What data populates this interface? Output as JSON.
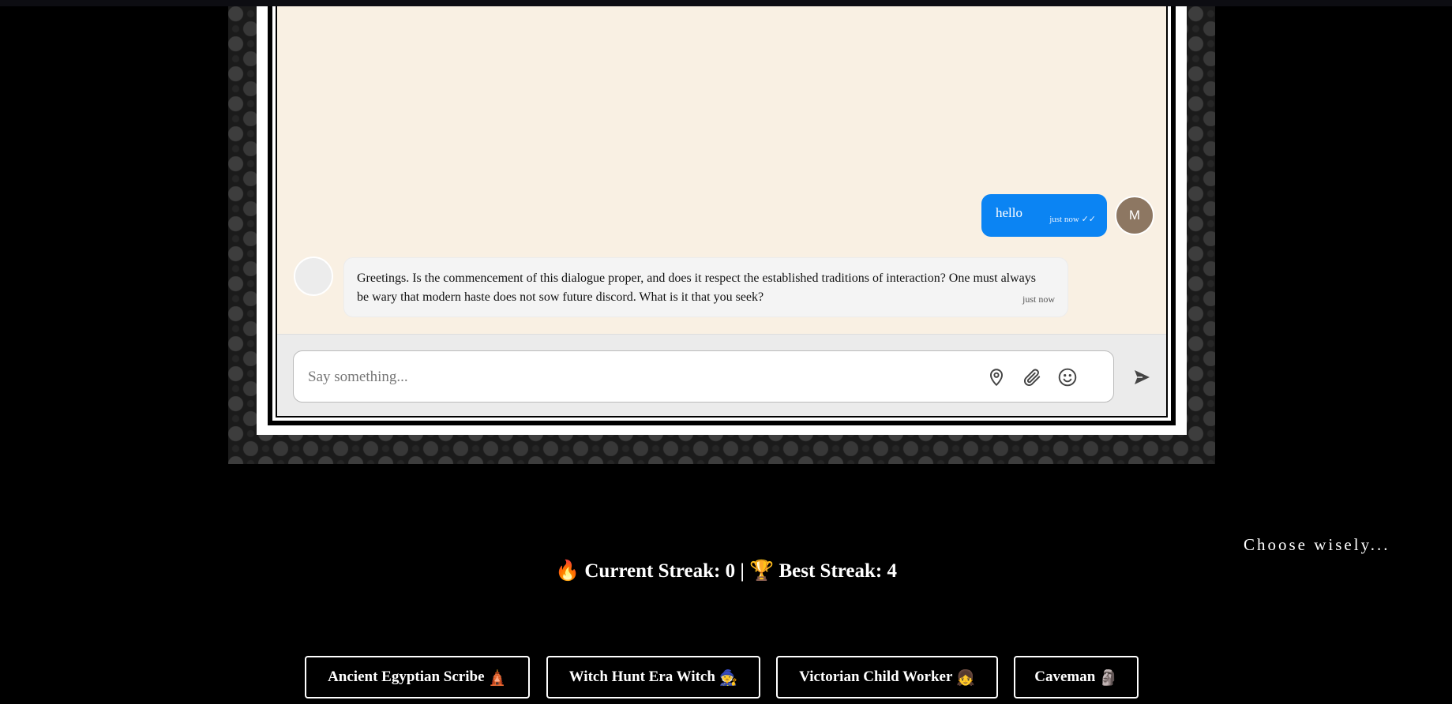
{
  "chat": {
    "messages": [
      {
        "sender": "user",
        "avatar": "M",
        "text": "hello",
        "time": "just now",
        "status": "✓✓"
      },
      {
        "sender": "bot",
        "text": "Greetings. Is the commencement of this dialogue proper, and does it respect the established traditions of interaction? One must always be wary that modern haste does not sow future discord. What is it that you seek?",
        "time": "just now"
      }
    ],
    "input": {
      "placeholder": "Say something...",
      "value": ""
    },
    "icons": [
      "location-pin-icon",
      "paperclip-icon",
      "smiley-icon",
      "send-icon"
    ]
  },
  "tagline": "Choose wisely...",
  "streak": {
    "current_icon": "🔥",
    "current_text": "Current Streak: 0 |",
    "best_icon": "🏆",
    "best_text": "Best Streak: 4"
  },
  "choices": [
    {
      "label": "Ancient Egyptian Scribe",
      "emoji": "🛕"
    },
    {
      "label": "Witch Hunt Era Witch",
      "emoji": "🧙"
    },
    {
      "label": "Victorian Child Worker",
      "emoji": "👧"
    },
    {
      "label": "Caveman",
      "emoji": "🗿"
    }
  ],
  "colors": {
    "bubble_user": "#0b84f3",
    "chat_bg": "#f9f0e3",
    "avatar_user": "#8d7762"
  }
}
